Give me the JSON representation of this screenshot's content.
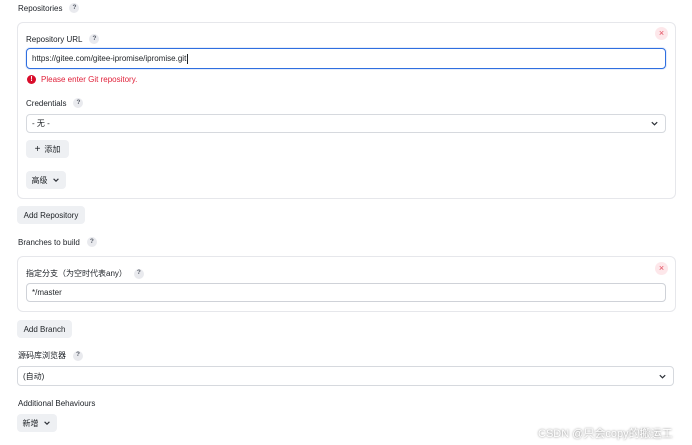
{
  "repositories": {
    "section_label": "Repositories",
    "repo_url_label": "Repository URL",
    "repo_url_value": "https://gitee.com/gitee-ipromise/ipromise.git",
    "error_text": "Please enter Git repository.",
    "error_icon": "!",
    "credentials_label": "Credentials",
    "credentials_value": "- 无 -",
    "add_button_label": "添加",
    "advanced_button_label": "高级",
    "add_repository_label": "Add Repository"
  },
  "branches": {
    "section_label": "Branches to build",
    "branch_spec_label": "指定分支（为空时代表any）",
    "branch_spec_value": "*/master",
    "add_branch_label": "Add Branch"
  },
  "repo_browser": {
    "label": "源码库浏览器",
    "value": "(自动)"
  },
  "additional_behaviours": {
    "label": "Additional Behaviours",
    "add_label": "新增"
  },
  "icons": {
    "help": "?",
    "close": "×",
    "plus": "+"
  },
  "watermark": "CSDN @只会copy的搬运工",
  "colors": {
    "focus_border": "#2f6fe0",
    "error": "#e0213a",
    "close_bg": "#fde7ea",
    "close_fg": "#e24a5b"
  }
}
